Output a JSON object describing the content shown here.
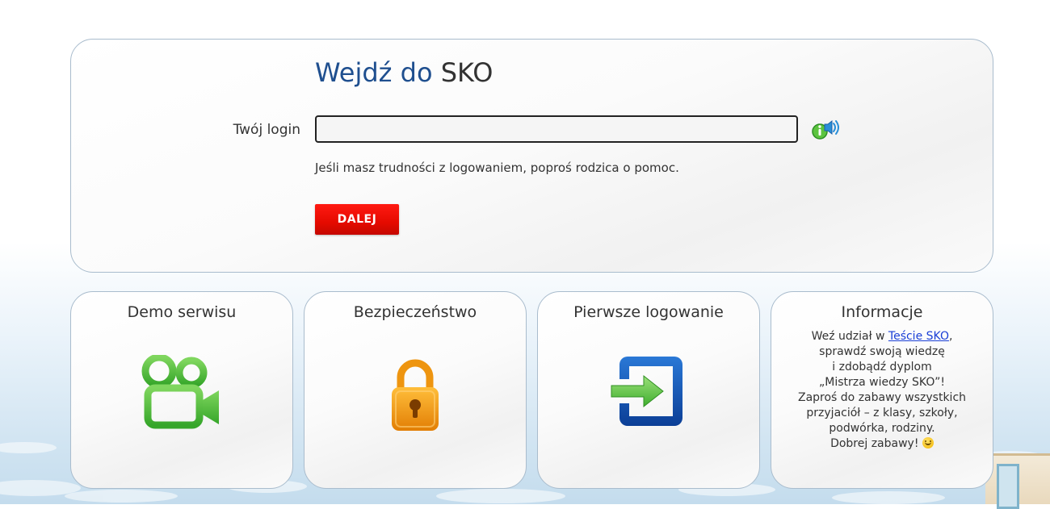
{
  "login": {
    "title_prefix": "Wejdź do",
    "title_brand": "SKO",
    "login_label": "Twój login",
    "login_value": "",
    "help_text": "Jeśli masz trudności z logowaniem, poproś rodzica o pomoc.",
    "next_label": "DALEJ",
    "audio_icon": "info-speaker-icon"
  },
  "tiles": {
    "demo": {
      "title": "Demo serwisu",
      "icon": "video-camera-icon"
    },
    "security": {
      "title": "Bezpieczeństwo",
      "icon": "padlock-icon"
    },
    "first_login": {
      "title": "Pierwsze logowanie",
      "icon": "enter-arrow-icon"
    },
    "info": {
      "title": "Informacje",
      "line1_prefix": "Weź udział w ",
      "line1_link": "Teście SKO",
      "line1_suffix": ",",
      "line2": "sprawdź swoją wiedzę",
      "line3": "i zdobądź dyplom",
      "line4": "„Mistrza wiedzy SKO”!",
      "line5": "Zaproś do zabawy wszystkich",
      "line6": "przyjaciół – z klasy, szkoły,",
      "line7": "podwórka, rodziny.",
      "line8": "Dobrej zabawy!",
      "emoji": "smiley-icon"
    }
  },
  "colors": {
    "title_blue": "#1f4f8f",
    "button_red": "#e50a00",
    "demo_green": "#4cba3a",
    "lock_orange": "#f09a12",
    "enter_blue": "#0f4fae",
    "link_blue": "#1a3fd6"
  }
}
